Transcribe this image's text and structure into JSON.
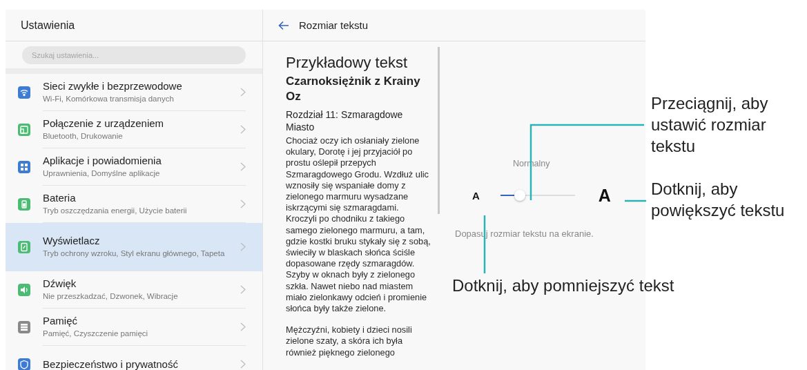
{
  "settings": {
    "title": "Ustawienia",
    "search": {
      "placeholder": "Szukaj ustawienia..."
    },
    "items": [
      {
        "color": "#3d7bd4",
        "title": "Sieci zwykłe i bezprzewodowe",
        "subtitle": "Wi-Fi, Komórkowa transmisja danych",
        "selected": false
      },
      {
        "color": "#4cbb74",
        "title": "Połączenie z urządzeniem",
        "subtitle": "Bluetooth, Drukowanie",
        "selected": false
      },
      {
        "color": "#3d7bd4",
        "title": "Aplikacje i powiadomienia",
        "subtitle": "Uprawnienia, Domyślne aplikacje",
        "selected": false
      },
      {
        "color": "#4cbb74",
        "title": "Bateria",
        "subtitle": "Tryb oszczędzania energii, Użycie baterii",
        "selected": false
      },
      {
        "color": "#4cbb74",
        "title": "Wyświetlacz",
        "subtitle": "Tryb ochrony wzroku, Styl ekranu głównego, Tapeta",
        "selected": true
      },
      {
        "color": "#4cbb74",
        "title": "Dźwięk",
        "subtitle": "Nie przeszkadzać, Dzwonek, Wibracje",
        "selected": false
      },
      {
        "color": "#8a8a8a",
        "title": "Pamięć",
        "subtitle": "Pamięć, Czyszczenie pamięci",
        "selected": false
      },
      {
        "color": "#3d7bd4",
        "title": "Bezpieczeństwo i prywatność",
        "selected": false
      }
    ]
  },
  "text_size": {
    "title": "Rozmiar tekstu",
    "preview": {
      "heading": "Przykładowy tekst",
      "book_title": "Czarnoksiężnik z Krainy Oz",
      "chapter": "Rozdział 11: Szmaragdowe Miasto",
      "paragraphs": [
        "Chociaż oczy ich osłaniały zielone okulary, Dorotę i jej przyjaciół po prostu oślepił przepych Szmaragdowego Grodu. Wzdłuż ulic wznosiły się wspaniałe domy z zielonego marmuru wysadzane iskrzącymi się szmaragdami. Kroczyli po chodniku z takiego samego zielonego marmuru, a tam, gdzie kostki bruku stykały się z sobą, świeciły w blaskach słońca ściśle dopasowane rzędy szmaragdów. Szyby w oknach były z zielonego szkła. Nawet niebo nad miastem miało zielonkawy odcień i promienie słońca były także zielone.",
        "Mężczyźni, kobiety i dzieci nosili zielone szaty, a skóra ich była również pięknego zielonego"
      ]
    },
    "slider": {
      "label": "Normalny",
      "small_label": "A",
      "large_label": "A",
      "level": 0.26
    },
    "hint": "Dopasuj rozmiar tekstu na ekranie."
  },
  "callouts": [
    "Przeciągnij, aby ustawić rozmiar tekstu",
    "Dotknij, aby powiększyć tekstu",
    "Dotknij, aby pomniejszyć tekst"
  ]
}
